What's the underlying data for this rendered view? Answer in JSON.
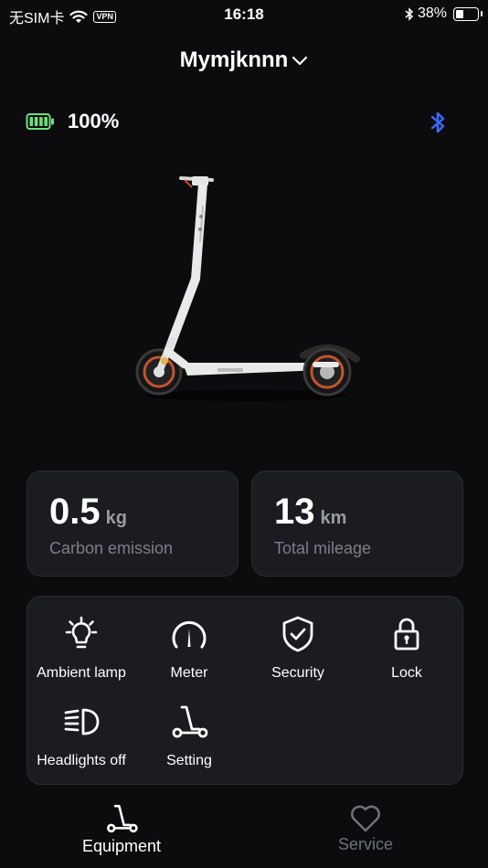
{
  "status_bar": {
    "carrier": "无SIM卡",
    "vpn": "VPN",
    "time": "16:18",
    "battery_pct": "38%",
    "battery_level": 0.38
  },
  "header": {
    "device_name": "Mymjknnn"
  },
  "battery": {
    "percent": "100%",
    "level": 1.0,
    "color": "#6ee07a"
  },
  "bluetooth_color": "#3b6bff",
  "stats": [
    {
      "value": "0.5",
      "unit": "kg",
      "label": "Carbon emission"
    },
    {
      "value": "13",
      "unit": "km",
      "label": "Total mileage"
    }
  ],
  "features": [
    {
      "label": "Ambient lamp",
      "icon": "lamp-icon"
    },
    {
      "label": "Meter",
      "icon": "meter-icon"
    },
    {
      "label": "Security",
      "icon": "shield-check-icon"
    },
    {
      "label": "Lock",
      "icon": "lock-icon"
    },
    {
      "label": "Headlights off",
      "icon": "headlight-icon"
    },
    {
      "label": "Setting",
      "icon": "scooter-icon"
    }
  ],
  "tabbar": {
    "tabs": [
      {
        "label": "Equipment",
        "icon": "scooter-icon",
        "active": true
      },
      {
        "label": "Service",
        "icon": "heart-icon",
        "active": false
      }
    ]
  }
}
